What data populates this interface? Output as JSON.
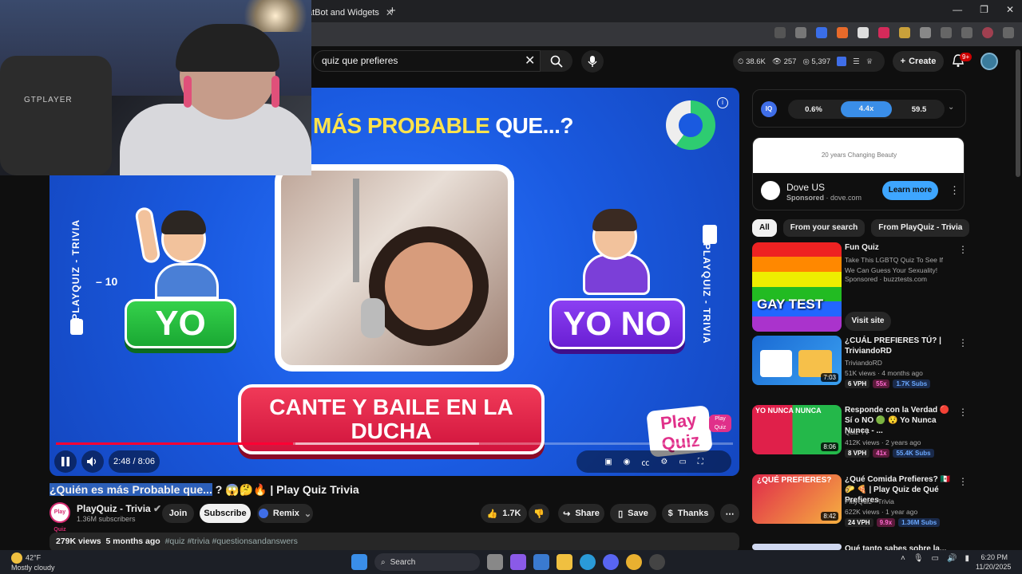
{
  "browser": {
    "tab_title": "atBot and Widgets",
    "tab_close": "✕",
    "new_tab": "+",
    "window_controls": [
      "—",
      "❐",
      "✕"
    ]
  },
  "header": {
    "search_value": "quiz que prefieres",
    "stats": {
      "likes": "38.6K",
      "views": "257",
      "subs": "5,397"
    },
    "create_label": "Create",
    "notif_count": "9+"
  },
  "video": {
    "heading_yellow": "MÁS PROBABLE",
    "heading_white": "QUE...?",
    "side_text": "PLAYQUIZ - TRIVIA",
    "minus_ten": "– 10",
    "yo": "YO",
    "yono": "YO NO",
    "banner_line1": "CANTE Y BAILE EN LA",
    "banner_line2": "DUCHA",
    "logo_text": "Play Quiz",
    "logo_small": "Play Quiz",
    "time": "2:48 / 8:06",
    "progress": 0.35,
    "info_icon": "i"
  },
  "meta": {
    "title_highlight": "¿Quién es más Probable que...",
    "title_rest": " ? 😱🤔🔥 | Play Quiz Trivia",
    "channel_initials": "Play Quiz",
    "channel_name": "PlayQuiz - Trivia",
    "subscribers": "1.36M subscribers",
    "join": "Join",
    "subscribe": "Subscribe",
    "remix": "Remix",
    "likes": "1.7K",
    "share": "Share",
    "save": "Save",
    "thanks": "Thanks",
    "views": "279K views",
    "age": "5 months ago",
    "tags": "#quiz #trivia #questionsandanswers"
  },
  "sidebar": {
    "iq_logo": "IQ",
    "iq_values": [
      "0.6%",
      "4.4x",
      "59.5"
    ],
    "ad": {
      "banner": "20 years Changing Beauty",
      "name": "Dove US",
      "sponsored": "Sponsored",
      "domain": "dove.com",
      "cta": "Learn more"
    },
    "chips": [
      "All",
      "From your search",
      "From PlayQuiz - Trivia"
    ],
    "recs": [
      {
        "title": "Fun Quiz",
        "line2": "Take This LGBTQ Quiz To See If We Can Guess Your Sexuality!",
        "meta": "Sponsored · buzztests.com",
        "cta": "Visit site",
        "thumb_text": "GAY TEST"
      },
      {
        "title": "¿CUÁL PREFIERES TÚ? | TriviandoRD",
        "channel": "TriviandoRD",
        "meta": "51K views · 4 months ago",
        "duration": "7:03",
        "b1": "6 VPH",
        "b2": "55x",
        "b3": "1.7K Subs"
      },
      {
        "title": "Responde con la Verdad 🔴 Sí o NO 🟢 😯 Yo Nunca Nunca - ...",
        "channel": "Quiz TV",
        "meta": "412K views · 2 years ago",
        "duration": "8:06",
        "thumb_text": "YO NUNCA NUNCA",
        "b1": "8 VPH",
        "b2": "41x",
        "b3": "55.4K Subs"
      },
      {
        "title": "¿Qué Comida Prefieres? 🇲🇽 🌮 🍕 | Play Quiz de Qué Prefieres",
        "channel": "PlayQuiz - Trivia",
        "meta": "622K views · 1 year ago",
        "duration": "8:42",
        "thumb_text": "¿QUÉ PREFIERES?",
        "b1": "24 VPH",
        "b2": "9.9x",
        "b3": "1.36M Subs"
      },
      {
        "title": "Qué tanto sabes sobre la..."
      }
    ]
  },
  "taskbar": {
    "temp": "42°F",
    "weather": "Mostly cloudy",
    "search": "Search",
    "time": "6:20 PM",
    "date": "11/20/2025"
  },
  "webcam": {
    "chair_label": "GTPLAYER"
  },
  "colors": {
    "accent_red": "#ff0033",
    "video_blue": "#1a5ae0",
    "yo_green": "#1aa833",
    "yono_purple": "#6a1fd4"
  }
}
